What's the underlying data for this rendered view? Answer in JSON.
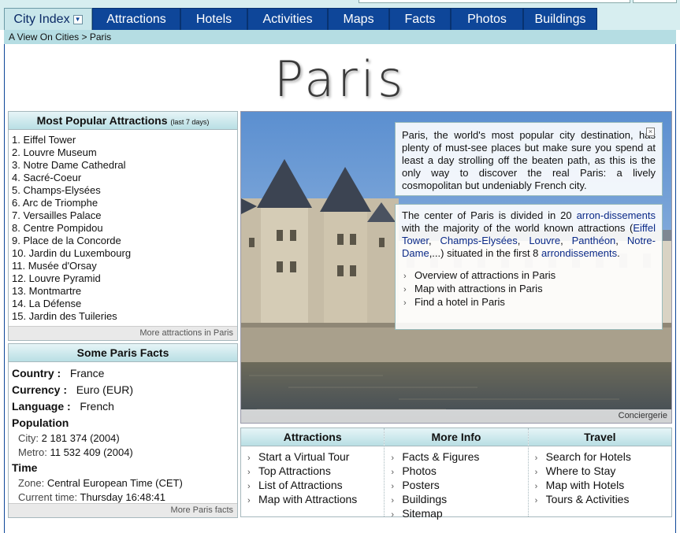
{
  "nav": {
    "tabs": [
      {
        "label": "City Index"
      },
      {
        "label": "Attractions"
      },
      {
        "label": "Hotels"
      },
      {
        "label": "Activities"
      },
      {
        "label": "Maps"
      },
      {
        "label": "Facts"
      },
      {
        "label": "Photos"
      },
      {
        "label": "Buildings"
      }
    ]
  },
  "breadcrumb": "A View On Cities > Paris",
  "city_title": "Paris",
  "popular": {
    "title": "Most Popular Attractions",
    "subtitle": "(last 7 days)",
    "items": [
      "1. Eiffel Tower",
      "2. Louvre Museum",
      "3. Notre Dame Cathedral",
      "4. Sacré-Coeur",
      "5. Champs-Elysées",
      "6. Arc de Triomphe",
      "7. Versailles Palace",
      "8. Centre Pompidou",
      "9. Place de la Concorde",
      "10. Jardin du Luxembourg",
      "11. Musée d'Orsay",
      "12. Louvre Pyramid",
      "13. Montmartre",
      "14. La Défense",
      "15. Jardin des Tuileries"
    ],
    "more_link": "More attractions in Paris"
  },
  "facts": {
    "title": "Some Paris Facts",
    "country_label": "Country :",
    "country": "France",
    "currency_label": "Currency :",
    "currency": "Euro (EUR)",
    "language_label": "Language :",
    "language": "French",
    "population_label": "Population",
    "city_label": "City:",
    "city_pop": "2 181 374 (2004)",
    "metro_label": "Metro:",
    "metro_pop": "11 532 409 (2004)",
    "time_label": "Time",
    "zone_label": "Zone:",
    "zone": "Central European Time (CET)",
    "current_label": "Current time:",
    "current": "Thursday 16:48:41",
    "more_link": "More Paris facts"
  },
  "photo": {
    "caption": "Conciergerie"
  },
  "intro": {
    "text": "Paris, the world's most popular city destination, has plenty of must-see places but make sure you spend at least a day strolling off the beaten path, as this is the only way to discover the real Paris: a lively cosmopolitan but undeniably French city.",
    "close_glyph": "×"
  },
  "center": {
    "t1": "The center of Paris is divided in 20 ",
    "arr_link": "arron-dissements",
    "t2": " with the majority of the world known attractions (",
    "l1": "Eiffel Tower",
    "sep1": ", ",
    "l2": "Champs-Elysées",
    "sep2": ", ",
    "l3": "Louvre",
    "sep3": ", ",
    "l4": "Panthéon",
    "sep4": ", ",
    "l5": "Notre-Dame",
    "t3": ",...) situated in the first 8 ",
    "l6": "arrondissements",
    "t4": "."
  },
  "quick_links": [
    "Overview of attractions in Paris",
    "Map with attractions in Paris",
    "Find a hotel in Paris"
  ],
  "bottom": {
    "attractions": {
      "title": "Attractions",
      "items": [
        "Start a Virtual Tour",
        "Top Attractions",
        "List of Attractions",
        "Map with Attractions"
      ]
    },
    "more_info": {
      "title": "More Info",
      "items": [
        "Facts & Figures",
        "Photos",
        "Posters",
        "Buildings",
        "Sitemap"
      ]
    },
    "travel": {
      "title": "Travel",
      "items": [
        "Search for Hotels",
        "Where to Stay",
        "Map with Hotels",
        "Tours & Activities"
      ]
    }
  },
  "colors": {
    "nav_blue": "#0e4699",
    "header_teal": "#b5dde3",
    "link": "#0b2a88"
  }
}
